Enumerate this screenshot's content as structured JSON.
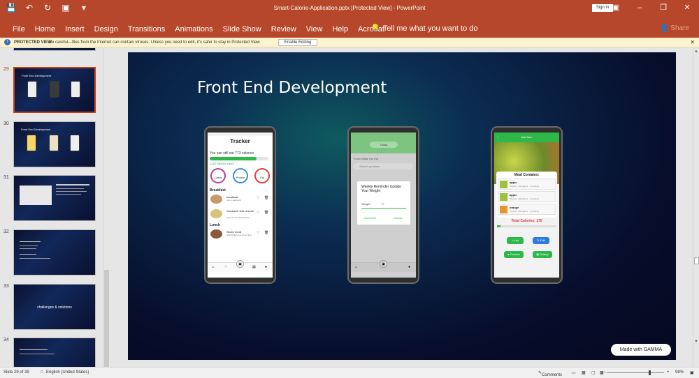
{
  "window": {
    "title": "Smart-Calorie-Application.pptx [Protected View] - PowerPoint",
    "sign_in": "Sign in"
  },
  "ribbon": {
    "tabs": [
      "File",
      "Home",
      "Insert",
      "Design",
      "Transitions",
      "Animations",
      "Slide Show",
      "Review",
      "View",
      "Help",
      "Acrobat"
    ],
    "tell_me": "Tell me what you want to do",
    "share": "Share"
  },
  "protected_view": {
    "label": "PROTECTED VIEW",
    "message": "Be careful—files from the Internet can contain viruses. Unless you need to edit, it's safer to stay in Protected View.",
    "button": "Enable Editing"
  },
  "thumbnails": [
    {
      "num": "29",
      "title": "Front End Development",
      "selected": true
    },
    {
      "num": "30",
      "title": "Front End Development",
      "selected": false
    },
    {
      "num": "31",
      "title": "",
      "selected": false
    },
    {
      "num": "32",
      "title": "",
      "selected": false
    },
    {
      "num": "33",
      "title": "challenges & solutions",
      "selected": false
    },
    {
      "num": "34",
      "title": "",
      "selected": false
    }
  ],
  "slide": {
    "title": "Front End Development",
    "badge": "Made with GAMMA",
    "phone1": {
      "header": "Tracker",
      "remaining": "You can still eat 773 calories",
      "meter": "1343 calories eaten",
      "rings": [
        "Carbs",
        "Protein",
        "Fat"
      ],
      "section_breakfast": "Breakfast",
      "meal1": "breakfast",
      "meal1_sub": "cup & sandwich",
      "meal2": "Sandwich feta cheese",
      "meal2_sub": "Mexican lindseed bread",
      "section_lunch": "Lunch",
      "meal3": "Sliced meat",
      "meal3_sub": "Grilled fillet gets grounding"
    },
    "phone2": {
      "tab": "Today",
      "heading": "Know What You Eat",
      "search": "Search products",
      "dialog_title": "Weekly Reminder Update Your Weight",
      "weight_label": "Weight",
      "weight_value": "73",
      "cancel": "Cancelled",
      "update": "Update"
    },
    "phone3": {
      "header": "Add Item",
      "panel_title": "Meal Contains:",
      "items": [
        {
          "name": "apple",
          "desc": "52 kcal · 100 grams · 1 portions"
        },
        {
          "name": "apple",
          "desc": "52 kcal · 100 grams · 1 portions"
        },
        {
          "name": "orange",
          "desc": "47 kcal · 100 grams · 1 portions"
        }
      ],
      "total": "Total Calories: 170",
      "btn_add": "Add",
      "btn_edit": "Edit",
      "btn_camera": "Camera",
      "btn_gallery": "Gallery"
    }
  },
  "status": {
    "slide": "Slide 29 of 39",
    "language": "English (United States)",
    "comments": "Comments",
    "zoom": "98%"
  },
  "colors": {
    "accent": "#b7472a",
    "app_green": "#2eb84a",
    "total_red": "#e0383a"
  }
}
